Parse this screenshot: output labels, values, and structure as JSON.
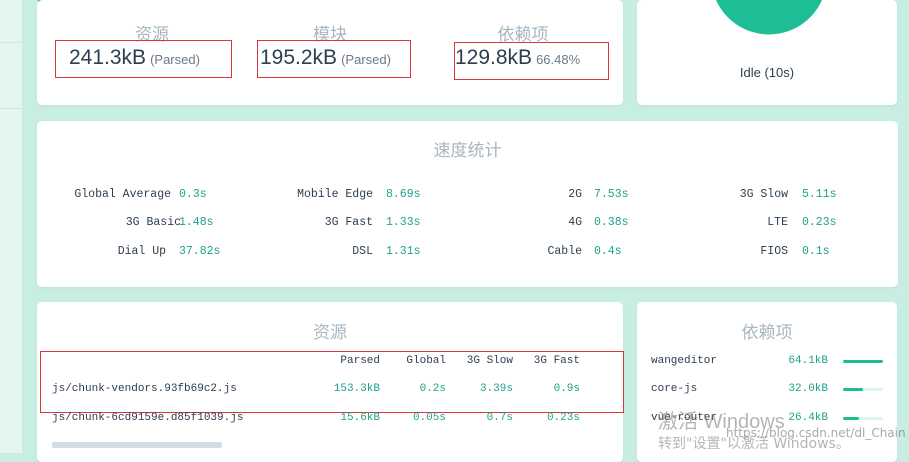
{
  "assets_summary": {
    "assets": {
      "title": "资源",
      "value": "241.3kB",
      "note": "(Parsed)"
    },
    "modules": {
      "title": "模块",
      "value": "195.2kB",
      "note": "(Parsed)"
    },
    "dependencies": {
      "title": "依赖项",
      "value": "129.8kB",
      "note": "66.48%"
    }
  },
  "status": {
    "label": "Idle (10s)"
  },
  "speed_stats": {
    "title": "速度统计",
    "items": [
      {
        "label": "Global Average",
        "value": "0.3s"
      },
      {
        "label": "Mobile Edge",
        "value": "8.69s"
      },
      {
        "label": "2G",
        "value": "7.53s"
      },
      {
        "label": "3G Slow",
        "value": "5.11s"
      },
      {
        "label": "3G Basic",
        "value": "1.48s"
      },
      {
        "label": "3G Fast",
        "value": "1.33s"
      },
      {
        "label": "4G",
        "value": "0.38s"
      },
      {
        "label": "LTE",
        "value": "0.23s"
      },
      {
        "label": "Dial Up",
        "value": "37.82s"
      },
      {
        "label": "DSL",
        "value": "1.31s"
      },
      {
        "label": "Cable",
        "value": "0.4s"
      },
      {
        "label": "FIOS",
        "value": "0.1s"
      }
    ]
  },
  "assets_table": {
    "title": "资源",
    "headers": [
      "Parsed",
      "Global",
      "3G Slow",
      "3G Fast"
    ],
    "rows": [
      {
        "file": "js/chunk-vendors.93fb69c2.js",
        "cells": [
          "153.3kB",
          "0.2s",
          "3.39s",
          "0.9s"
        ]
      },
      {
        "file": "js/chunk-6cd9159e.d85f1039.js",
        "cells": [
          "15.6kB",
          "0.05s",
          "0.7s",
          "0.23s"
        ]
      }
    ]
  },
  "deps_panel": {
    "title": "依赖项",
    "items": [
      {
        "name": "wangeditor",
        "size": "64.1kB",
        "fraction": 1.0
      },
      {
        "name": "core-js",
        "size": "32.0kB",
        "fraction": 0.5
      },
      {
        "name": "vue-router",
        "size": "26.4kB",
        "fraction": 0.41
      }
    ]
  },
  "watermark": {
    "activate": "激活 Windows",
    "goto": "转到\"设置\"以激活 Windows。",
    "source": "https://blog.csdn.net/dl_Chain"
  },
  "colors": {
    "accent": "#1dbd95",
    "value_text": "#1fa38a",
    "page_bg": "#c8ede3",
    "highlight_box": "#d9363e"
  }
}
